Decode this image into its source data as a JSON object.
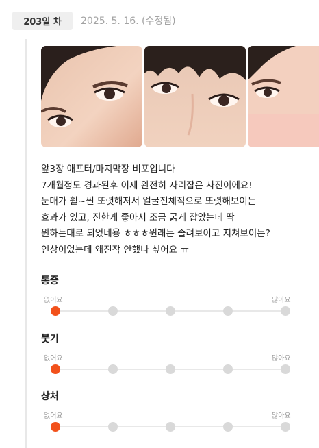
{
  "header": {
    "day_label": "203일 차",
    "date": "2025. 5. 16. (수정됨)"
  },
  "photos": [
    {
      "icon": "face-eyes-photo"
    },
    {
      "icon": "face-eyes-photo"
    },
    {
      "icon": "face-eyes-photo"
    }
  ],
  "post": {
    "lines": [
      "앞3장 애프터/마지막장 비포입니다",
      "7개월정도 경과된후 이제 완전히 자리잡은 사진이에요!",
      "눈매가 훨~씬 또렷해져서 얼굴전체적으로 또렷해보이는",
      "효과가 있고, 진한게 좋아서 조금 굵게 잡았는데 딱",
      "원하는대로 되었네용 ㅎㅎㅎ원래는 졸려보이고 지쳐보이는?",
      "인상이었는데 왜진작 안했나 싶어요 ㅠ"
    ]
  },
  "ratings": [
    {
      "title": "통증",
      "min_label": "없어요",
      "max_label": "많아요",
      "level": 1,
      "scale": 5
    },
    {
      "title": "붓기",
      "min_label": "없어요",
      "max_label": "많아요",
      "level": 1,
      "scale": 5
    },
    {
      "title": "상처",
      "min_label": "없어요",
      "max_label": "많아요",
      "level": 1,
      "scale": 5
    }
  ],
  "colors": {
    "accent": "#f2511b",
    "inactive_dot": "#d9d9d9",
    "track": "#e8e8e8"
  }
}
